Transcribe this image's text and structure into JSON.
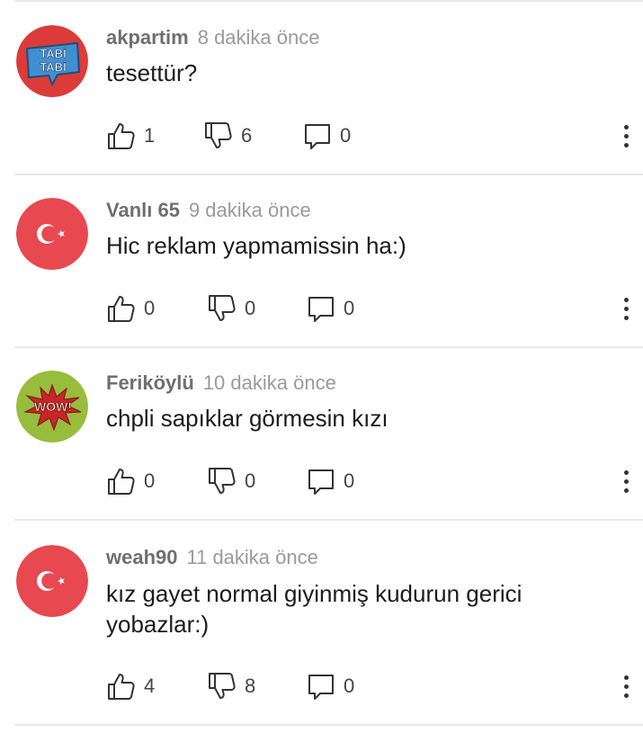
{
  "comments": [
    {
      "author": "akpartim",
      "time": "8 dakika önce",
      "text": "tesettür?",
      "avatar": {
        "type": "tabi",
        "label_top": "TABİ",
        "label_bottom": "TABİ"
      },
      "likes": "1",
      "dislikes": "6",
      "replies": "0"
    },
    {
      "author": "Vanlı 65",
      "time": "9 dakika önce",
      "text": "Hic reklam yapmamissin ha:)",
      "avatar": {
        "type": "flag"
      },
      "likes": "0",
      "dislikes": "0",
      "replies": "0"
    },
    {
      "author": "Feriköylü",
      "time": "10 dakika önce",
      "text": "chpli sapıklar görmesin kızı",
      "avatar": {
        "type": "wow",
        "label": "WOW!"
      },
      "likes": "0",
      "dislikes": "0",
      "replies": "0"
    },
    {
      "author": "weah90",
      "time": "11 dakika önce",
      "text": "kız gayet normal giyinmiş kudurun gerici yobazlar:)",
      "avatar": {
        "type": "flag"
      },
      "likes": "4",
      "dislikes": "8",
      "replies": "0"
    }
  ],
  "colors": {
    "flag_red": "#e8484f",
    "tabi_red": "#dd3b39",
    "tabi_blue": "#3f8fd1",
    "wow_green": "#98bd3c",
    "wow_red": "#c8242a"
  },
  "icons": {
    "like": "thumbs-up-icon",
    "dislike": "thumbs-down-icon",
    "reply": "comment-bubble-icon",
    "more": "more-vertical-icon"
  }
}
